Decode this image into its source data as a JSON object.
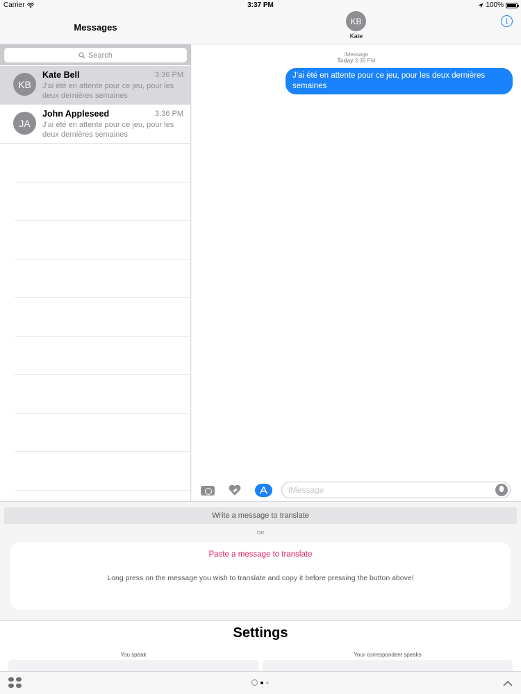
{
  "status_bar": {
    "carrier": "Carrier",
    "time": "3:37 PM",
    "battery": "100%",
    "battery_level": 1.0
  },
  "messages_list": {
    "title": "Messages",
    "search_placeholder": "Search",
    "conversations": [
      {
        "initials": "KB",
        "name": "Kate Bell",
        "time": "3:36 PM",
        "preview": "J'ai été en attente pour ce jeu, pour les deux dernières semaines",
        "selected": true
      },
      {
        "initials": "JA",
        "name": "John Appleseed",
        "time": "3:36 PM",
        "preview": "J'ai été en attente pour ce jeu, pour les deux dernières semaines",
        "selected": false
      }
    ]
  },
  "thread": {
    "contact_initials": "KB",
    "contact_name": "Kate",
    "service": "iMessage",
    "day": "Today",
    "time": "3:36 PM",
    "message": "J'ai été en attente pour ce jeu, pour les deux dernières semaines",
    "input_placeholder": "iMessage"
  },
  "translator": {
    "write_button": "Write a message to translate",
    "or": "OR",
    "paste_button": "Paste a message to translate",
    "help_text": "Long press on the message you wish to translate and copy it before pressing the button above!"
  },
  "settings": {
    "title": "Settings",
    "you_speak": "You speak",
    "correspondent_speaks": "Your correspondent speaks"
  },
  "colors": {
    "accent": "#1a82fb",
    "paste_link": "#e0245e",
    "avatar": "#8e8e93"
  }
}
